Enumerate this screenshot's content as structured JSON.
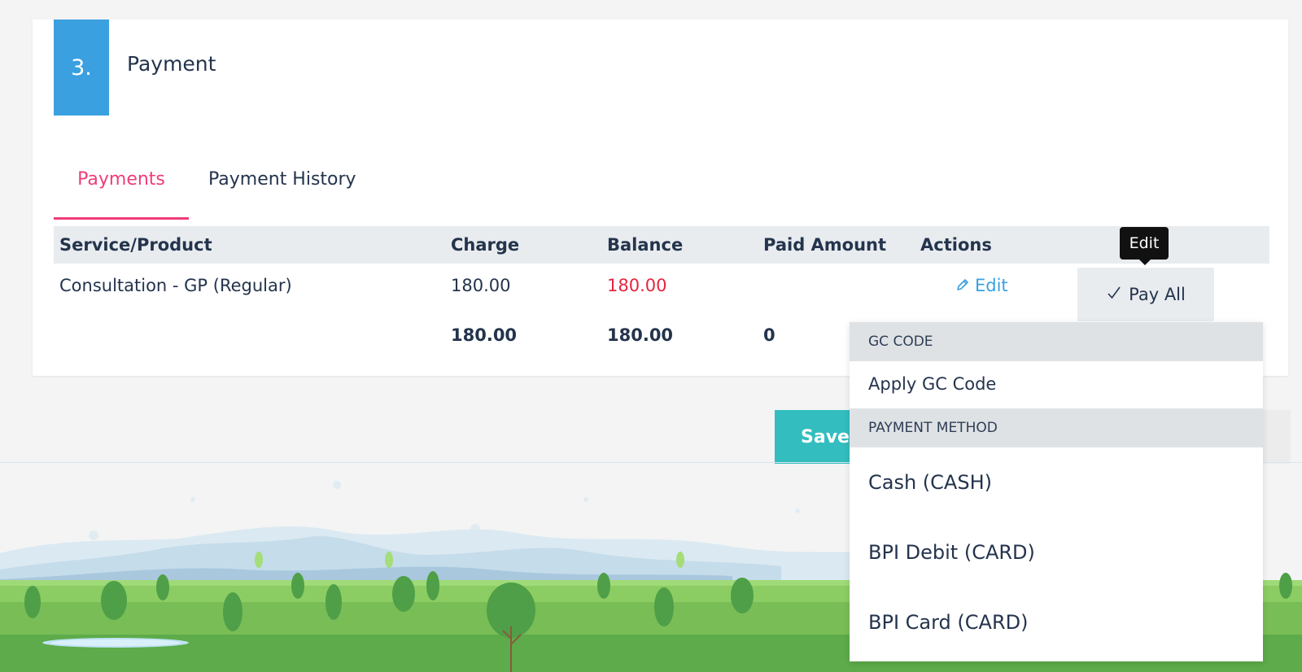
{
  "section": {
    "step_number": "3.",
    "title": "Payment"
  },
  "tabs": [
    {
      "label": "Payments",
      "active": true
    },
    {
      "label": "Payment History",
      "active": false
    }
  ],
  "table": {
    "headers": [
      "Service/Product",
      "Charge",
      "Balance",
      "Paid Amount",
      "Actions"
    ],
    "rows": [
      {
        "service": "Consultation - GP (Regular)",
        "charge": "180.00",
        "balance": "180.00",
        "paid_amount": "",
        "action_label": "Edit"
      }
    ],
    "totals": {
      "charge": "180.00",
      "balance": "180.00",
      "paid_amount": "0"
    }
  },
  "pay_all": {
    "label": "Pay All",
    "tooltip": "Edit"
  },
  "save": {
    "label": "Save"
  },
  "dropdown": {
    "groups": [
      {
        "header": "GC CODE",
        "items": [
          "Apply GC Code"
        ]
      },
      {
        "header": "PAYMENT METHOD",
        "items": [
          "Cash (CASH)",
          "BPI Debit (CARD)",
          "BPI Card (CARD)"
        ]
      }
    ]
  },
  "colors": {
    "accent_blue": "#3aa0e0",
    "tab_active": "#ee3d77",
    "balance_red": "#e5263e",
    "save_teal": "#33bdbf",
    "text_dark": "#24344d"
  }
}
